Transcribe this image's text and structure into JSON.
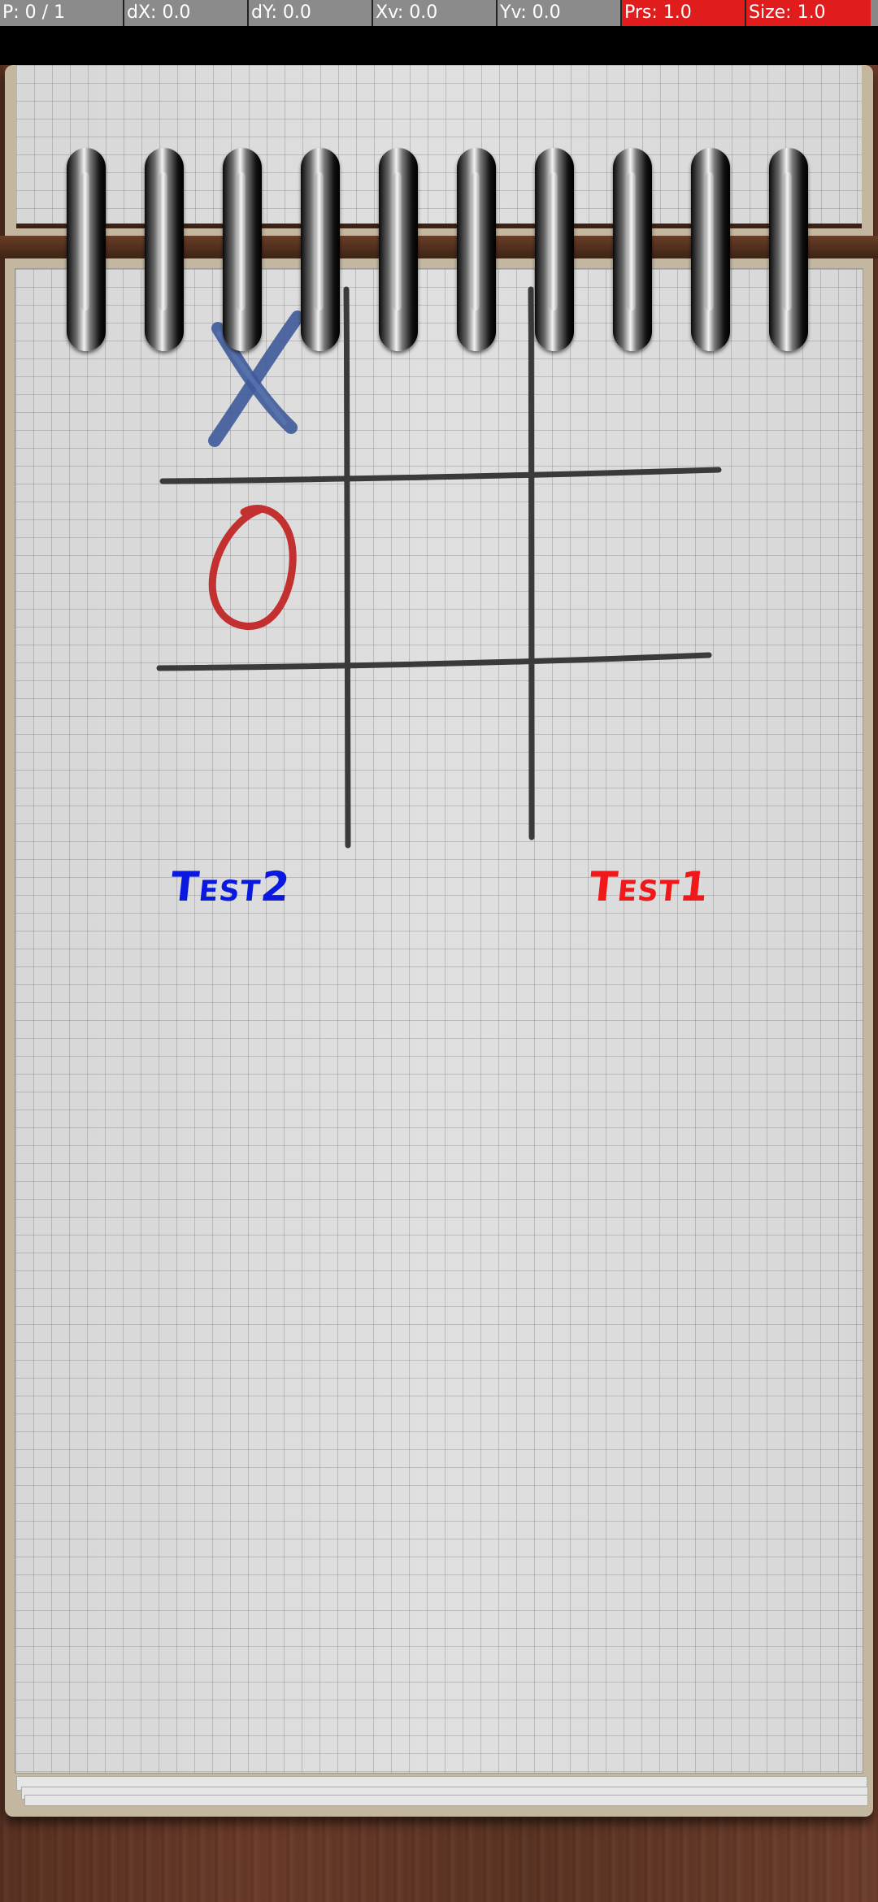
{
  "status_bar": {
    "cells": [
      {
        "text": "P: 0 / 1",
        "color": "#8b8b8b"
      },
      {
        "text": "dX: 0.0",
        "color": "#8b8b8b"
      },
      {
        "text": "dY: 0.0",
        "color": "#8b8b8b"
      },
      {
        "text": "Xv: 0.0",
        "color": "#8b8b8b"
      },
      {
        "text": "Yv: 0.0",
        "color": "#8b8b8b"
      },
      {
        "text": "Prs: 1.0",
        "color": "#e11c1c"
      },
      {
        "text": "Size: 1.0",
        "color": "#e11c1c"
      }
    ]
  },
  "game": {
    "board": [
      [
        "X",
        "",
        ""
      ],
      [
        "O",
        "",
        ""
      ],
      [
        "",
        "",
        ""
      ]
    ],
    "x_color": "#3e5a9a",
    "o_color": "#c23030",
    "line_color": "#3a3a3a"
  },
  "players": {
    "left": {
      "name": "Test2",
      "color": "#0a18e0"
    },
    "right": {
      "name": "Test1",
      "color": "#f01818"
    }
  }
}
